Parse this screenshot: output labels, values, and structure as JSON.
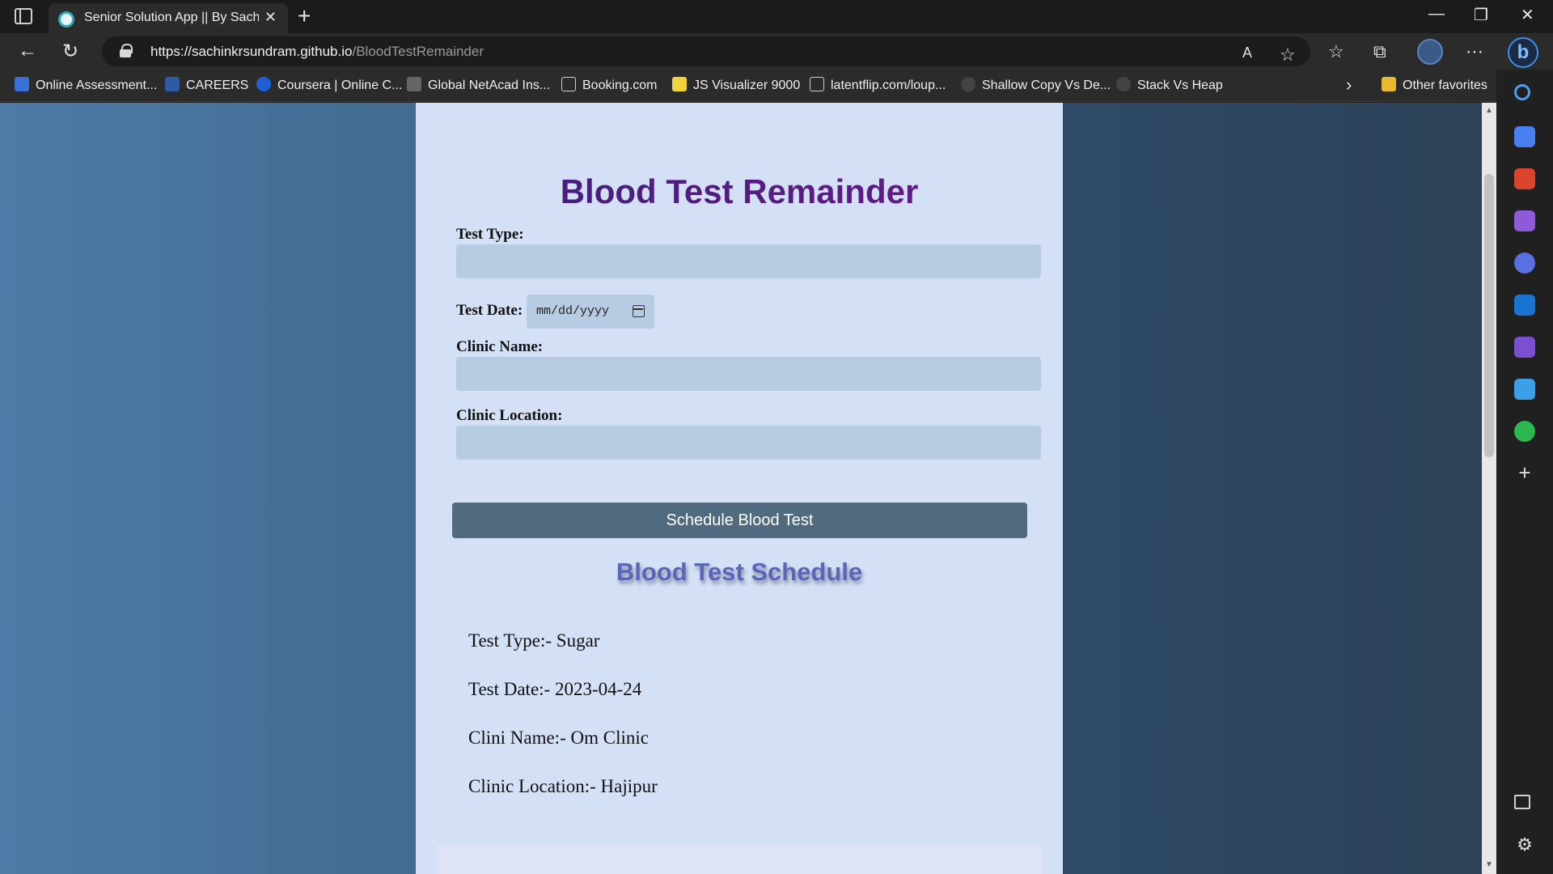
{
  "browser": {
    "tab_title": "Senior Solution App || By Sachink",
    "url_host": "https://sachinkrsundram.github.io",
    "url_path": "/BloodTestRemainder",
    "favorites": [
      {
        "label": "Online Assessment...",
        "color": "#3a6fd8"
      },
      {
        "label": "CAREERS",
        "color": "#2e5aa8"
      },
      {
        "label": "Coursera | Online C...",
        "color": "#1f5fd6"
      },
      {
        "label": "Global NetAcad Ins...",
        "color": "#666666"
      },
      {
        "label": "Booking.com",
        "color": "#cfcfcf"
      },
      {
        "label": "JS Visualizer 9000",
        "color": "#f2d43a"
      },
      {
        "label": "latentflip.com/loup...",
        "color": "#cfcfcf"
      },
      {
        "label": "Shallow Copy Vs De...",
        "color": "#444444"
      },
      {
        "label": "Stack Vs Heap",
        "color": "#444444"
      }
    ],
    "other_favorites": "Other favorites"
  },
  "page": {
    "title": "Blood Test Remainder",
    "form": {
      "test_type_label": "Test Type:",
      "test_date_label": "Test Date:",
      "test_date_placeholder": "mm/dd/yyyy",
      "clinic_name_label": "Clinic Name:",
      "clinic_location_label": "Clinic Location:",
      "submit_label": "Schedule Blood Test"
    },
    "schedule_title": "Blood Test Schedule",
    "schedule": {
      "test_type": "Test Type:- Sugar",
      "test_date": "Test Date:- 2023-04-24",
      "clinic_name": "Clini Name:- Om Clinic",
      "clinic_location": "Clinic Location:- Hajipur"
    }
  },
  "colors": {
    "title_gradient_start": "#3e1f7a",
    "title_gradient_end": "#6a1b8a",
    "button_bg": "#506a80",
    "card_bg": "#d4e0f5",
    "field_bg": "#b7cbe3"
  }
}
